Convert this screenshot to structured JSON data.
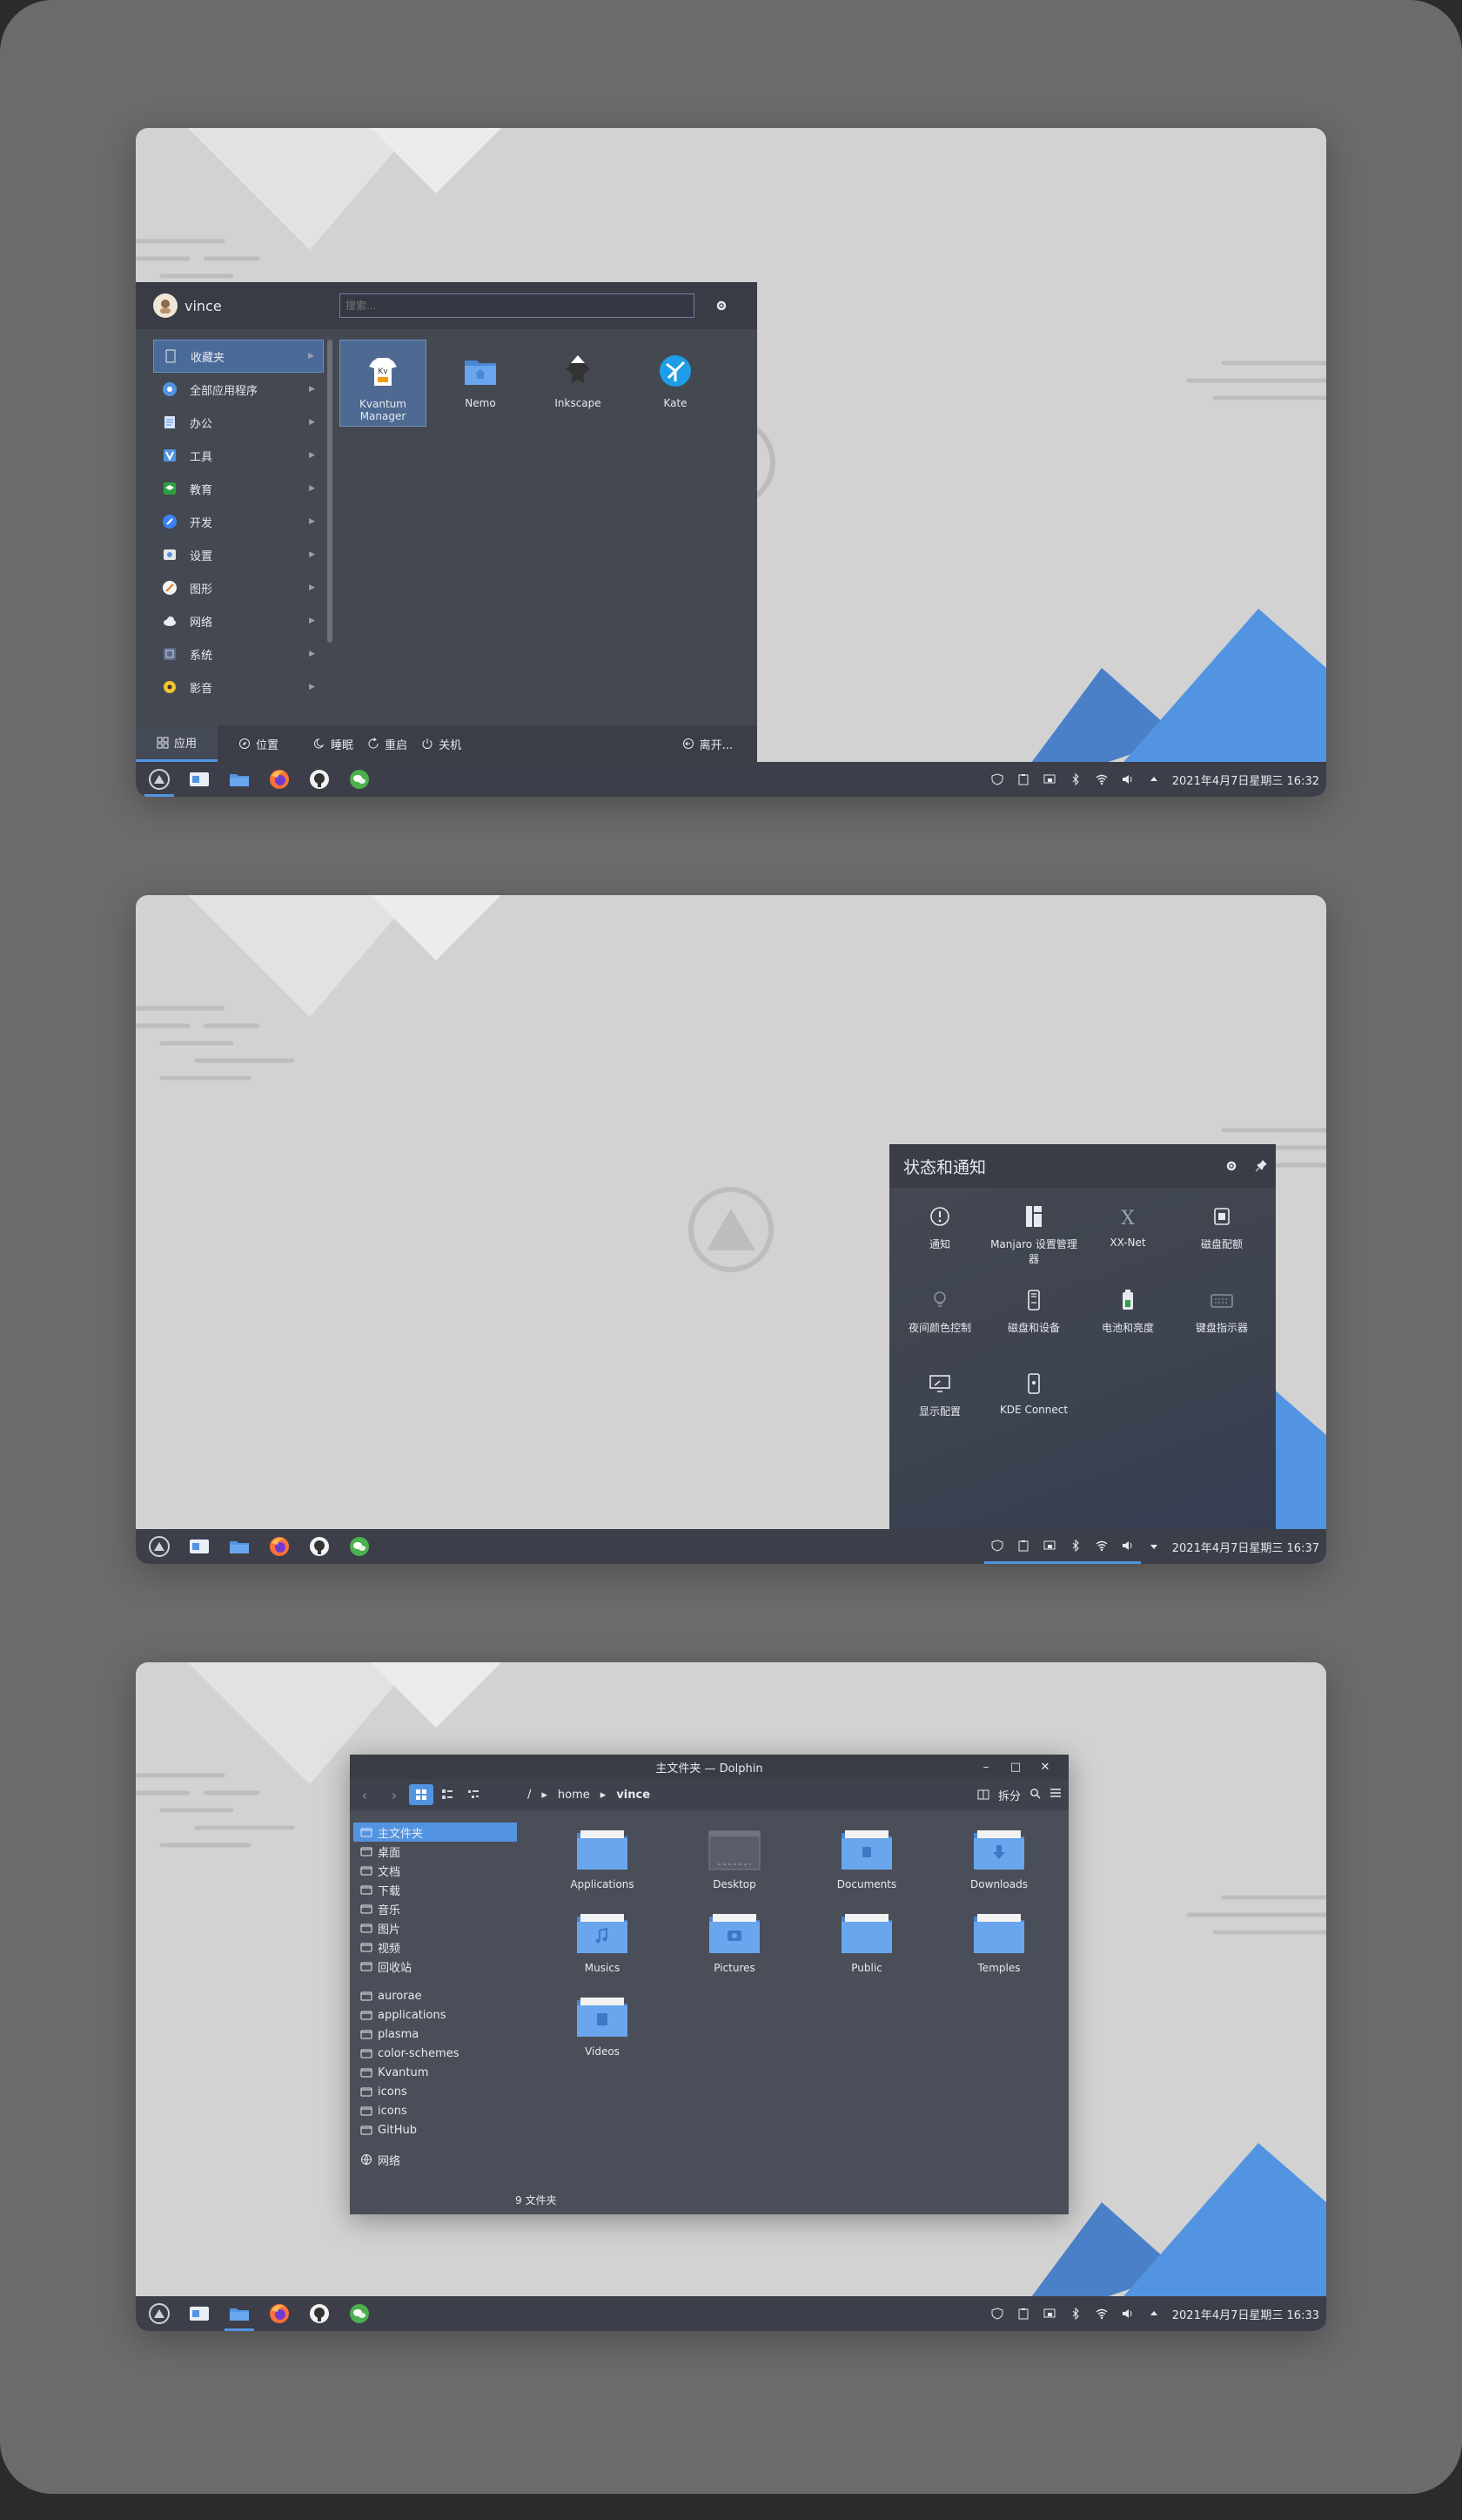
{
  "colors": {
    "accent": "#5294e2",
    "panel": "#3c3f49",
    "wallpaper": "#d2d2d2"
  },
  "taskbar": {
    "apps": [
      "manjaro-logo",
      "files-icon",
      "folder-icon",
      "firefox-icon",
      "github-icon",
      "wechat-icon"
    ],
    "tray": [
      "shield-icon",
      "clipboard-icon",
      "display-icon",
      "bluetooth-icon",
      "wifi-icon",
      "volume-icon",
      "arrow-up-icon"
    ],
    "clock1": "2021年4月7日星期三 16:32",
    "clock2": "2021年4月7日星期三 16:37",
    "clock3": "2021年4月7日星期三 16:33"
  },
  "startmenu": {
    "username": "vince",
    "search_placeholder": "搜索...",
    "categories": [
      {
        "label": "收藏夹",
        "icon": "bookmark-icon",
        "color": "#4a6a9a"
      },
      {
        "label": "全部应用程序",
        "icon": "apps-icon",
        "color": "#5294e2"
      },
      {
        "label": "办公",
        "icon": "office-icon",
        "color": "#d7e3f7"
      },
      {
        "label": "工具",
        "icon": "tools-icon",
        "color": "#5294e2"
      },
      {
        "label": "教育",
        "icon": "education-icon",
        "color": "#2ea043"
      },
      {
        "label": "开发",
        "icon": "development-icon",
        "color": "#3b82f6"
      },
      {
        "label": "设置",
        "icon": "settings-icon",
        "color": "#e8e8e8"
      },
      {
        "label": "图形",
        "icon": "graphics-icon",
        "color": "#f5f5f5"
      },
      {
        "label": "网络",
        "icon": "network-icon",
        "color": "#e8eef8"
      },
      {
        "label": "系统",
        "icon": "system-icon",
        "color": "#5b6b8a"
      },
      {
        "label": "影音",
        "icon": "multimedia-icon",
        "color": "#f4c430"
      }
    ],
    "apps": [
      {
        "label": "Kvantum Manager",
        "icon": "kvantum-icon"
      },
      {
        "label": "Nemo",
        "icon": "nemo-folder-icon"
      },
      {
        "label": "Inkscape",
        "icon": "inkscape-icon"
      },
      {
        "label": "Kate",
        "icon": "kate-icon"
      }
    ],
    "tabs": {
      "apps": "应用",
      "places": "位置"
    },
    "power": {
      "sleep": "睡眠",
      "restart": "重启",
      "shutdown": "关机",
      "leave": "离开..."
    }
  },
  "status_panel": {
    "title": "状态和通知",
    "items": [
      {
        "label": "通知",
        "icon": "notification-icon"
      },
      {
        "label": "Manjaro 设置管理器",
        "icon": "manjaro-settings-icon"
      },
      {
        "label": "XX-Net",
        "icon": "xxnet-icon"
      },
      {
        "label": "磁盘配额",
        "icon": "disk-quota-icon"
      },
      {
        "label": "夜间颜色控制",
        "icon": "night-color-icon"
      },
      {
        "label": "磁盘和设备",
        "icon": "disks-devices-icon"
      },
      {
        "label": "电池和亮度",
        "icon": "battery-icon"
      },
      {
        "label": "键盘指示器",
        "icon": "keyboard-icon"
      },
      {
        "label": "显示配置",
        "icon": "display-config-icon"
      },
      {
        "label": "KDE Connect",
        "icon": "kdeconnect-icon"
      }
    ]
  },
  "dolphin": {
    "title": "主文件夹 — Dolphin",
    "breadcrumb": {
      "root": "/",
      "home": "home",
      "current": "vince"
    },
    "split_label": "拆分",
    "places": [
      "主文件夹",
      "桌面",
      "文档",
      "下载",
      "音乐",
      "图片",
      "视频",
      "回收站",
      "aurorae",
      "applications",
      "plasma",
      "color-schemes",
      "Kvantum",
      "icons",
      "icons",
      "GitHub"
    ],
    "network_label": "网络",
    "files": [
      "Applications",
      "Desktop",
      "Documents",
      "Downloads",
      "Musics",
      "Pictures",
      "Public",
      "Temples",
      "Videos"
    ],
    "status": "9 文件夹"
  }
}
